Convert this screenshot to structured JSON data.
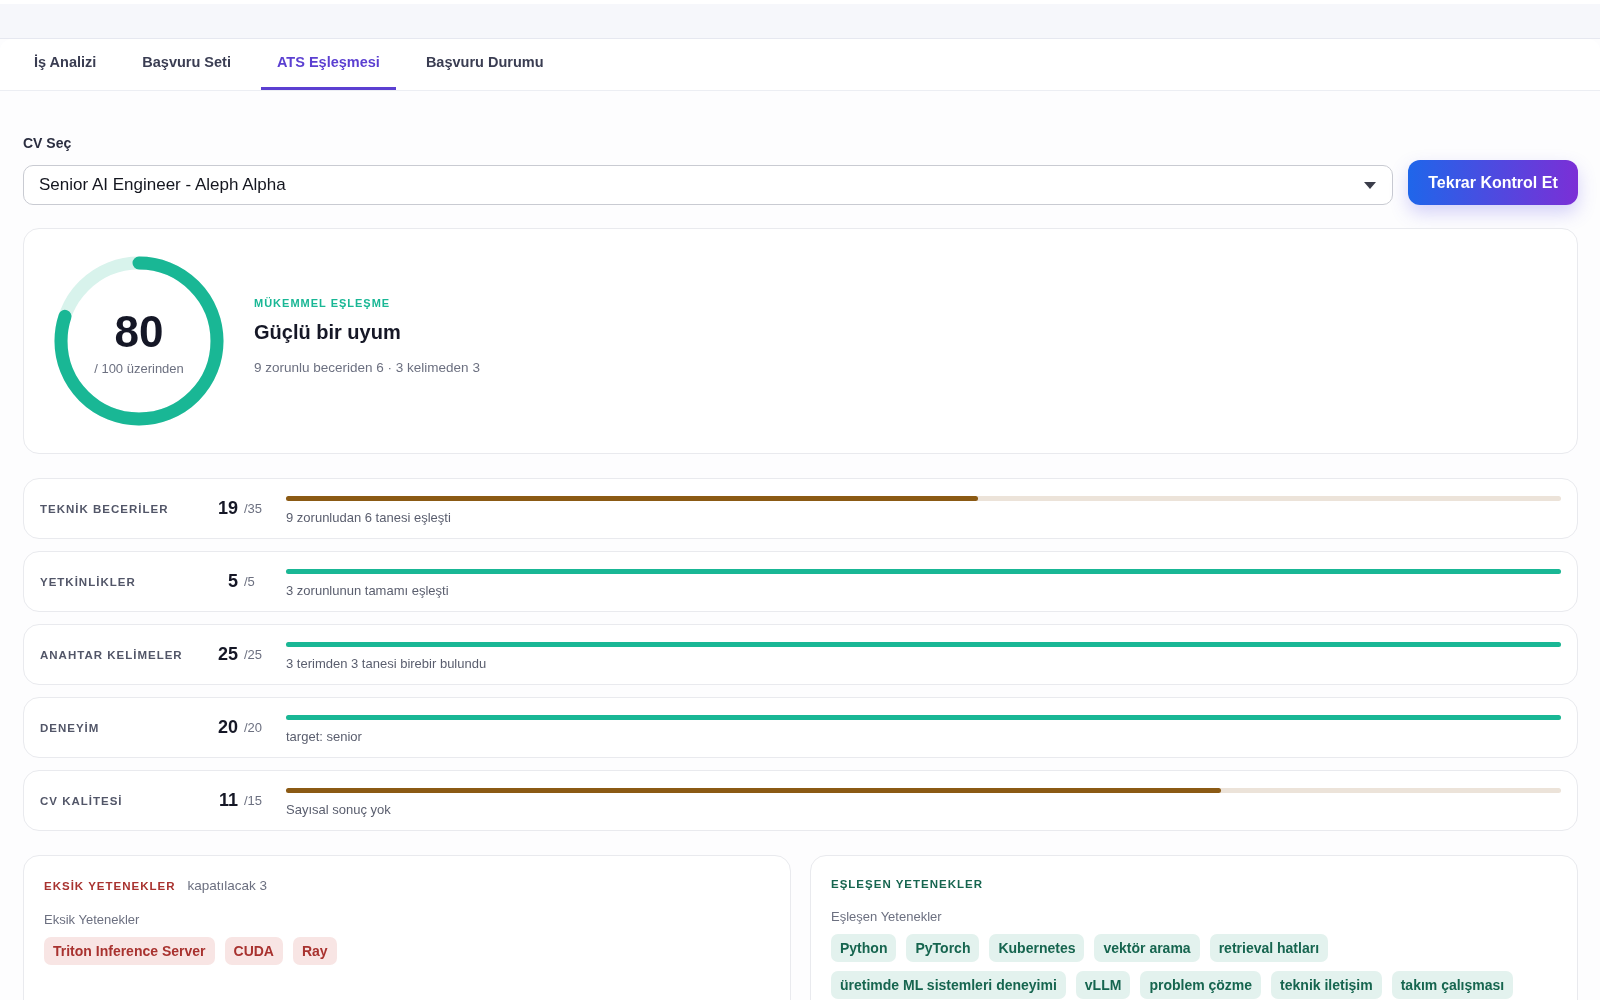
{
  "tabs": [
    {
      "label": "İş Analizi",
      "selected": false
    },
    {
      "label": "Başvuru Seti",
      "selected": false
    },
    {
      "label": "ATS Eşleşmesi",
      "selected": true
    },
    {
      "label": "Başvuru Durumu",
      "selected": false
    }
  ],
  "cv_select": {
    "label": "CV Seç",
    "value": "Senior AI Engineer - Aleph Alpha"
  },
  "recheck_button": "Tekrar Kontrol Et",
  "score": {
    "value": "80",
    "out_of": "/ 100 üzerinden",
    "level": 0.8,
    "eyebrow": "MÜKEMMEL EŞLEŞME",
    "headline": "Güçlü bir uyum",
    "summary": "9 zorunlu beceriden 6 · 3 kelimeden 3"
  },
  "metrics": [
    {
      "label": "TEKNİK BECERİLER",
      "score": "19",
      "max": "/35",
      "level": 0.543,
      "color": "#8b5a14",
      "note": "9 zorunludan 6 tanesi eşleşti"
    },
    {
      "label": "YETKİNLİKLER",
      "score": "5",
      "max": "/5",
      "level": 1,
      "color": "#19b795",
      "note": "3 zorunlunun tamamı eşleşti"
    },
    {
      "label": "ANAHTAR KELİMELER",
      "score": "25",
      "max": "/25",
      "level": 1,
      "color": "#19b795",
      "note": "3 terimden 3 tanesi birebir bulundu"
    },
    {
      "label": "DENEYİM",
      "score": "20",
      "max": "/20",
      "level": 1,
      "color": "#19b795",
      "note": "target: senior"
    },
    {
      "label": "CV KALİTESİ",
      "score": "11",
      "max": "/15",
      "level": 0.733,
      "color": "#8b5a14",
      "note": "Sayısal sonuç yok"
    }
  ],
  "skill_panels": [
    {
      "kind": "missing",
      "title": "EKSİK YETENEKLER",
      "count": "kapatılacak 3",
      "subtitle": "Eksik Yetenekler",
      "tags": [
        "Triton Inference Server",
        "CUDA",
        "Ray"
      ]
    },
    {
      "kind": "matched",
      "title": "EŞLEŞEN YETENEKLER",
      "subtitle": "Eşleşen Yetenekler",
      "tags": [
        "Python",
        "PyTorch",
        "Kubernetes",
        "vektör arama",
        "retrieval hatları",
        "üretimde ML sistemleri deneyimi",
        "vLLM",
        "problem çözme",
        "teknik iletişim",
        "takım çalışması"
      ]
    }
  ]
}
